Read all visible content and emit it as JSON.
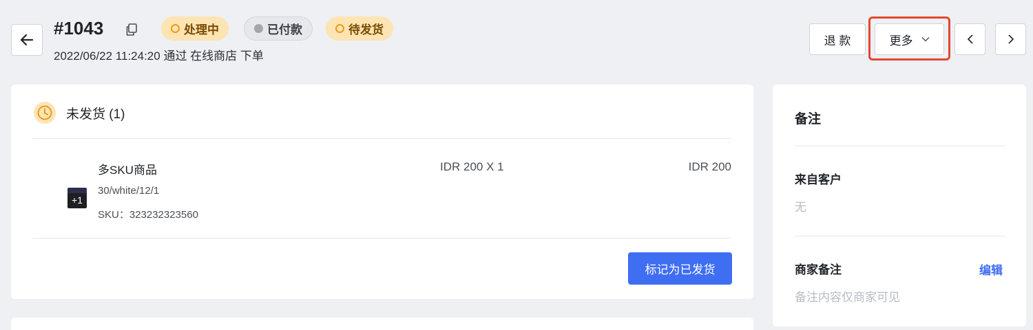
{
  "header": {
    "order_number": "#1043",
    "badges": [
      {
        "label": "处理中",
        "style": "orange"
      },
      {
        "label": "已付款",
        "style": "gray"
      },
      {
        "label": "待发货",
        "style": "orange"
      }
    ],
    "subtitle": "2022/06/22 11:24:20 通过 在线商店 下单",
    "refund_label": "退 款",
    "more_label": "更多",
    "prev_icon": "chevron-left-icon",
    "next_icon": "chevron-right-icon",
    "back_icon": "arrow-left-icon",
    "copy_icon": "copy-icon"
  },
  "fulfillment": {
    "section_title": "未发货 (1)",
    "status_icon": "clock-icon",
    "item": {
      "name": "多SKU商品",
      "variant": "30/white/12/1",
      "sku": "SKU：323232323560",
      "thumb_badge": "+1",
      "price_qty": "IDR 200 X 1",
      "total": "IDR 200"
    },
    "mark_fulfilled_label": "标记为已发货"
  },
  "notes": {
    "title": "备注",
    "customer_label": "来自客户",
    "customer_value": "无",
    "merchant_label": "商家备注",
    "edit_label": "编辑",
    "merchant_placeholder": "备注内容仅商家可见"
  },
  "colors": {
    "primary": "#3f6ef3",
    "badge_orange_bg": "#fde4b3",
    "badge_orange_ring": "#f29a13",
    "highlight": "#e5462f"
  }
}
